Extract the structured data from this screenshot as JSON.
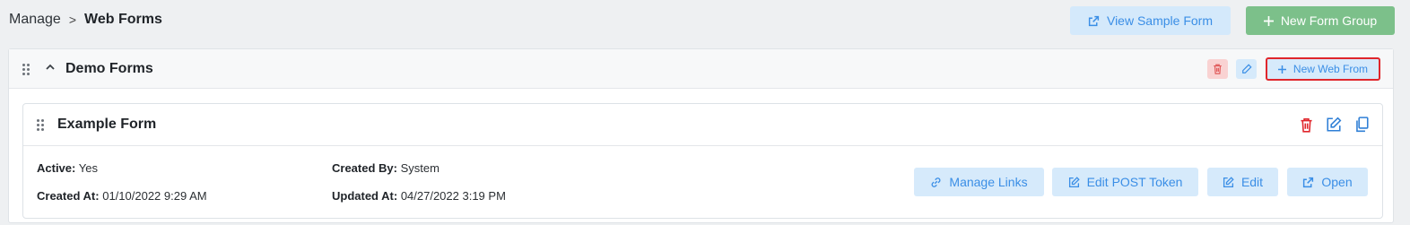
{
  "breadcrumb": {
    "parent": "Manage",
    "separator": ">",
    "current": "Web Forms"
  },
  "header_actions": {
    "view_sample_label": "View Sample Form",
    "new_group_label": "New Form Group"
  },
  "group": {
    "title": "Demo Forms",
    "new_web_form_label": "New Web From"
  },
  "form": {
    "title": "Example Form",
    "active_label": "Active:",
    "active_value": "Yes",
    "created_by_label": "Created By:",
    "created_by_value": "System",
    "created_at_label": "Created At:",
    "created_at_value": "01/10/2022 9:29 AM",
    "updated_at_label": "Updated At:",
    "updated_at_value": "04/27/2022 3:19 PM",
    "actions": {
      "manage_links": "Manage Links",
      "edit_post_token": "Edit POST Token",
      "edit": "Edit",
      "open": "Open"
    }
  },
  "icons": {
    "external_link": "external-link-icon",
    "plus": "plus-icon",
    "drag": "drag-handle-icon",
    "chevron_up": "chevron-up-icon",
    "trash": "trash-icon",
    "pencil": "pencil-icon",
    "edit_square": "edit-square-icon",
    "copy": "copy-icon",
    "link": "link-icon"
  },
  "colors": {
    "accent_blue": "#3a8ee6",
    "success_green": "#7cc08a",
    "danger_red": "#e0262c",
    "light_blue_bg": "#d6eafb"
  }
}
